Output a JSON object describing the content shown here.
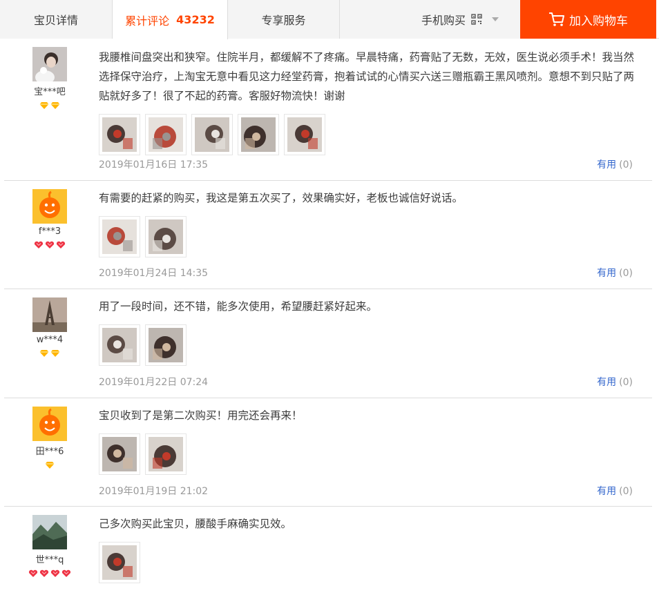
{
  "tabs": {
    "detail": "宝贝详情",
    "reviews_label": "累计评论",
    "reviews_count": "43232",
    "service": "专享服务",
    "mobile_buy": "手机购买",
    "add_to_cart": "加入购物车"
  },
  "colors": {
    "accent": "#ff4400",
    "link": "#3366cc",
    "muted": "#999999"
  },
  "reviews": [
    {
      "nick": "宝***吧",
      "badge_type": "yellow-diamond",
      "badge_count": 2,
      "text": "我腰椎间盘突出和狭窄。住院半月，都缓解不了疼痛。早晨特痛，药膏贴了无数，无效，医生说必须手术！我当然选择保守治疗，上淘宝无意中看见这力经堂药膏，抱着试试的心情买六送三赠瓶霸王黑风喷剂。意想不到只贴了两贴就好多了！很了不起的药膏。客服好物流快！谢谢",
      "photo_count": 5,
      "date": "2019年01月16日 17:35",
      "useful_label": "有用",
      "useful_count": "(0)"
    },
    {
      "nick": "f***3",
      "badge_type": "red-heart",
      "badge_count": 3,
      "text": "有需要的赶紧的购买，我这是第五次买了，效果确实好，老板也诚信好说话。",
      "photo_count": 2,
      "date": "2019年01月24日 14:35",
      "useful_label": "有用",
      "useful_count": "(0)"
    },
    {
      "nick": "w***4",
      "badge_type": "yellow-diamond",
      "badge_count": 2,
      "text": "用了一段时间，还不错，能多次使用，希望腰赶紧好起来。",
      "photo_count": 2,
      "date": "2019年01月22日 07:24",
      "useful_label": "有用",
      "useful_count": "(0)"
    },
    {
      "nick": "田***6",
      "badge_type": "yellow-diamond",
      "badge_count": 1,
      "text": "宝贝收到了是第二次购买！用完还会再来！",
      "photo_count": 2,
      "date": "2019年01月19日 21:02",
      "useful_label": "有用",
      "useful_count": "(0)"
    },
    {
      "nick": "世***q",
      "badge_type": "red-heart",
      "badge_count": 4,
      "text": "己多次购买此宝贝，腰酸手麻确实见效。",
      "photo_count": 1,
      "date": "",
      "useful_label": "",
      "useful_count": ""
    }
  ]
}
